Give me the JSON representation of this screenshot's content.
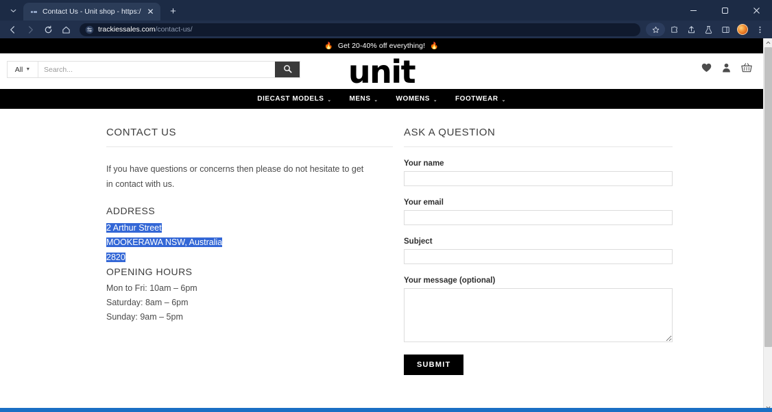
{
  "browser": {
    "tab": {
      "title": "Contact Us - Unit shop - https:/",
      "favicon_icon": "site-favicon",
      "close_icon": "close-icon"
    },
    "tab_list_icon": "chevron-down-icon",
    "new_tab_icon": "plus-icon",
    "window_controls": {
      "minimize": "minimize-icon",
      "maximize": "maximize-icon",
      "close": "close-icon"
    },
    "nav": {
      "back_icon": "back-arrow-icon",
      "forward_icon": "forward-arrow-icon",
      "reload_icon": "reload-icon",
      "home_icon": "home-icon"
    },
    "omnibox": {
      "site_info_icon": "tune-icon",
      "domain": "trackiessales.com",
      "path": "/contact-us/"
    },
    "toolbar_right": {
      "bookmark_icon": "star-icon",
      "extensions_icon": "extensions-icon",
      "share_icon": "share-icon",
      "lab_icon": "flask-icon",
      "sidepanel_icon": "side-panel-icon",
      "profile_icon": "profile-avatar",
      "menu_icon": "kebab-menu-icon"
    }
  },
  "promo": {
    "fire_left": "🔥",
    "text": "Get 20-40% off everything!",
    "fire_right": "🔥"
  },
  "header": {
    "search": {
      "scope_label": "All",
      "scope_caret_icon": "chevron-down-icon",
      "placeholder": "Search...",
      "value": "",
      "submit_icon": "search-icon"
    },
    "logo": "unit",
    "icons": [
      {
        "name": "wishlist-icon",
        "glyph": "heart"
      },
      {
        "name": "account-icon",
        "glyph": "person"
      },
      {
        "name": "cart-icon",
        "glyph": "basket"
      }
    ]
  },
  "mainnav": {
    "items": [
      {
        "label": "DIECAST MODELS",
        "caret": "⌄"
      },
      {
        "label": "MENS",
        "caret": "⌄"
      },
      {
        "label": "WOMENS",
        "caret": "⌄"
      },
      {
        "label": "FOOTWEAR",
        "caret": "⌄"
      }
    ]
  },
  "contact": {
    "heading": "CONTACT US",
    "intro": "If you have questions or concerns then please do not hesitate to get in contact with us.",
    "address_heading": "ADDRESS",
    "address_line1": "2 Arthur Street",
    "address_line2": "MOOKERAWA NSW, Australia",
    "address_line3": "2820",
    "hours_heading": "OPENING HOURS",
    "hours": [
      "Mon to Fri: 10am – 6pm",
      "Saturday: 8am – 6pm",
      "Sunday: 9am – 5pm"
    ]
  },
  "form": {
    "heading": "ASK A QUESTION",
    "name_label": "Your name",
    "name_value": "",
    "email_label": "Your email",
    "email_value": "",
    "subject_label": "Subject",
    "subject_value": "",
    "message_label": "Your message (optional)",
    "message_value": "",
    "submit_label": "SUBMIT"
  },
  "colors": {
    "chrome_tabstrip": "#1c2b45",
    "chrome_toolbar": "#21304c",
    "nav_black": "#000000",
    "selection_blue": "#3367d6",
    "accent_taskbar": "#1a6fc4"
  },
  "scrollbar": {
    "up_icon": "scroll-up-arrow",
    "down_icon": "scroll-down-arrow"
  }
}
